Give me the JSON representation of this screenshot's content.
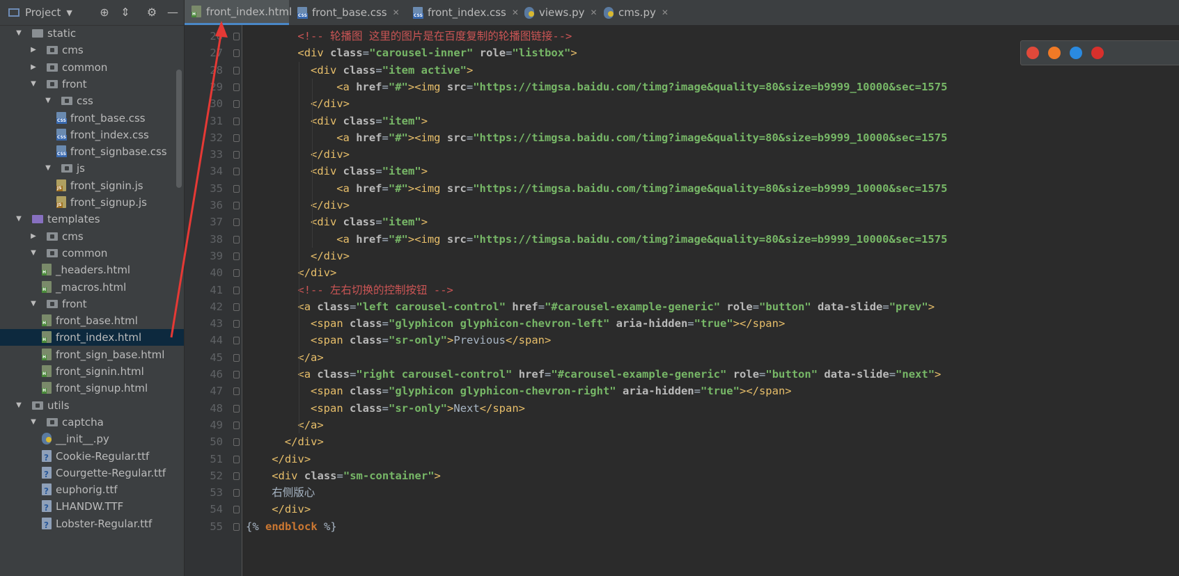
{
  "project_panel": {
    "title": "Project",
    "tree": [
      {
        "label": "static",
        "type": "folder-plain",
        "expanded": true,
        "depth": 0
      },
      {
        "label": "cms",
        "type": "folder",
        "expanded": false,
        "depth": 1
      },
      {
        "label": "common",
        "type": "folder",
        "expanded": false,
        "depth": 1
      },
      {
        "label": "front",
        "type": "folder",
        "expanded": true,
        "depth": 1
      },
      {
        "label": "css",
        "type": "folder",
        "expanded": true,
        "depth": 2
      },
      {
        "label": "front_base.css",
        "type": "css",
        "depth": 3
      },
      {
        "label": "front_index.css",
        "type": "css",
        "depth": 3
      },
      {
        "label": "front_signbase.css",
        "type": "css",
        "depth": 3
      },
      {
        "label": "js",
        "type": "folder",
        "expanded": true,
        "depth": 2
      },
      {
        "label": "front_signin.js",
        "type": "js",
        "depth": 3
      },
      {
        "label": "front_signup.js",
        "type": "js",
        "depth": 3
      },
      {
        "label": "templates",
        "type": "folder-purple",
        "expanded": true,
        "depth": 0
      },
      {
        "label": "cms",
        "type": "folder",
        "expanded": false,
        "depth": 1
      },
      {
        "label": "common",
        "type": "folder",
        "expanded": true,
        "depth": 1
      },
      {
        "label": "_headers.html",
        "type": "html",
        "depth": 2
      },
      {
        "label": "_macros.html",
        "type": "html",
        "depth": 2
      },
      {
        "label": "front",
        "type": "folder",
        "expanded": true,
        "depth": 1
      },
      {
        "label": "front_base.html",
        "type": "html",
        "depth": 2
      },
      {
        "label": "front_index.html",
        "type": "html",
        "depth": 2,
        "selected": true
      },
      {
        "label": "front_sign_base.html",
        "type": "html",
        "depth": 2
      },
      {
        "label": "front_signin.html",
        "type": "html",
        "depth": 2
      },
      {
        "label": "front_signup.html",
        "type": "html",
        "depth": 2
      },
      {
        "label": "utils",
        "type": "folder",
        "expanded": true,
        "depth": 0
      },
      {
        "label": "captcha",
        "type": "folder",
        "expanded": true,
        "depth": 1
      },
      {
        "label": "__init__.py",
        "type": "py",
        "depth": 2
      },
      {
        "label": "Cookie-Regular.ttf",
        "type": "ttf",
        "depth": 2
      },
      {
        "label": "Courgette-Regular.ttf",
        "type": "ttf",
        "depth": 2
      },
      {
        "label": "euphorig.ttf",
        "type": "ttf",
        "depth": 2
      },
      {
        "label": "LHANDW.TTF",
        "type": "ttf",
        "depth": 2
      },
      {
        "label": "Lobster-Regular.ttf",
        "type": "ttf",
        "depth": 2
      }
    ]
  },
  "tabs": [
    {
      "label": "front_index.html",
      "type": "html",
      "active": true
    },
    {
      "label": "front_base.css",
      "type": "css",
      "active": false
    },
    {
      "label": "front_index.css",
      "type": "css",
      "active": false
    },
    {
      "label": "views.py",
      "type": "py",
      "active": false
    },
    {
      "label": "cms.py",
      "type": "py",
      "active": false
    }
  ],
  "editor": {
    "lines": [
      {
        "n": "26",
        "indent": 4,
        "tokens": [
          [
            "comment",
            "<!-- 轮播图 这里的图片是在百度复制的轮播图链接-->"
          ]
        ]
      },
      {
        "n": "27",
        "indent": 4,
        "tokens": [
          [
            "tag",
            "<div "
          ],
          [
            "attrname",
            "class"
          ],
          [
            "txt",
            "="
          ],
          [
            "strv",
            "\"carousel-inner\""
          ],
          [
            "txt",
            " "
          ],
          [
            "attrname",
            "role"
          ],
          [
            "txt",
            "="
          ],
          [
            "strv",
            "\"listbox\""
          ],
          [
            "tag",
            ">"
          ]
        ]
      },
      {
        "n": "28",
        "indent": 5,
        "tokens": [
          [
            "tag",
            "<div "
          ],
          [
            "attrname",
            "class"
          ],
          [
            "txt",
            "="
          ],
          [
            "strv",
            "\"item active\""
          ],
          [
            "tag",
            ">"
          ]
        ]
      },
      {
        "n": "29",
        "indent": 7,
        "tokens": [
          [
            "tag",
            "<a "
          ],
          [
            "attrname",
            "href"
          ],
          [
            "txt",
            "="
          ],
          [
            "strv",
            "\"#\""
          ],
          [
            "tag",
            "><img "
          ],
          [
            "attrname",
            "src"
          ],
          [
            "txt",
            "="
          ],
          [
            "strv",
            "\"https://timgsa.baidu.com/timg?image&quality=80&size=b9999_10000&sec=1575"
          ]
        ]
      },
      {
        "n": "30",
        "indent": 5,
        "tokens": [
          [
            "tag",
            "</div>"
          ]
        ]
      },
      {
        "n": "31",
        "indent": 5,
        "tokens": [
          [
            "tag",
            "<div "
          ],
          [
            "attrname",
            "class"
          ],
          [
            "txt",
            "="
          ],
          [
            "strv",
            "\"item\""
          ],
          [
            "tag",
            ">"
          ]
        ]
      },
      {
        "n": "32",
        "indent": 7,
        "tokens": [
          [
            "tag",
            "<a "
          ],
          [
            "attrname",
            "href"
          ],
          [
            "txt",
            "="
          ],
          [
            "strv",
            "\"#\""
          ],
          [
            "tag",
            "><img "
          ],
          [
            "attrname",
            "src"
          ],
          [
            "txt",
            "="
          ],
          [
            "strv",
            "\"https://timgsa.baidu.com/timg?image&quality=80&size=b9999_10000&sec=1575"
          ]
        ]
      },
      {
        "n": "33",
        "indent": 5,
        "tokens": [
          [
            "tag",
            "</div>"
          ]
        ]
      },
      {
        "n": "34",
        "indent": 5,
        "tokens": [
          [
            "tag",
            "<div "
          ],
          [
            "attrname",
            "class"
          ],
          [
            "txt",
            "="
          ],
          [
            "strv",
            "\"item\""
          ],
          [
            "tag",
            ">"
          ]
        ]
      },
      {
        "n": "35",
        "indent": 7,
        "tokens": [
          [
            "tag",
            "<a "
          ],
          [
            "attrname",
            "href"
          ],
          [
            "txt",
            "="
          ],
          [
            "strv",
            "\"#\""
          ],
          [
            "tag",
            "><img "
          ],
          [
            "attrname",
            "src"
          ],
          [
            "txt",
            "="
          ],
          [
            "strv",
            "\"https://timgsa.baidu.com/timg?image&quality=80&size=b9999_10000&sec=1575"
          ]
        ]
      },
      {
        "n": "36",
        "indent": 5,
        "tokens": [
          [
            "tag",
            "</div>"
          ]
        ]
      },
      {
        "n": "37",
        "indent": 5,
        "tokens": [
          [
            "tag",
            "<div "
          ],
          [
            "attrname",
            "class"
          ],
          [
            "txt",
            "="
          ],
          [
            "strv",
            "\"item\""
          ],
          [
            "tag",
            ">"
          ]
        ]
      },
      {
        "n": "38",
        "indent": 7,
        "tokens": [
          [
            "tag",
            "<a "
          ],
          [
            "attrname",
            "href"
          ],
          [
            "txt",
            "="
          ],
          [
            "strv",
            "\"#\""
          ],
          [
            "tag",
            "><img "
          ],
          [
            "attrname",
            "src"
          ],
          [
            "txt",
            "="
          ],
          [
            "strv",
            "\"https://timgsa.baidu.com/timg?image&quality=80&size=b9999_10000&sec=1575"
          ]
        ]
      },
      {
        "n": "39",
        "indent": 5,
        "tokens": [
          [
            "tag",
            "</div>"
          ]
        ]
      },
      {
        "n": "40",
        "indent": 4,
        "tokens": [
          [
            "tag",
            "</div>"
          ]
        ]
      },
      {
        "n": "41",
        "indent": 4,
        "tokens": [
          [
            "comment",
            "<!-- 左右切换的控制按钮 -->"
          ]
        ]
      },
      {
        "n": "42",
        "indent": 4,
        "tokens": [
          [
            "tag",
            "<a "
          ],
          [
            "attrname",
            "class"
          ],
          [
            "txt",
            "="
          ],
          [
            "strv",
            "\"left carousel-control\""
          ],
          [
            "txt",
            " "
          ],
          [
            "attrname",
            "href"
          ],
          [
            "txt",
            "="
          ],
          [
            "strv",
            "\"#carousel-example-generic\""
          ],
          [
            "txt",
            " "
          ],
          [
            "attrname",
            "role"
          ],
          [
            "txt",
            "="
          ],
          [
            "strv",
            "\"button\""
          ],
          [
            "txt",
            " "
          ],
          [
            "attrname",
            "data-slide"
          ],
          [
            "txt",
            "="
          ],
          [
            "strv",
            "\"prev\""
          ],
          [
            "tag",
            ">"
          ]
        ]
      },
      {
        "n": "43",
        "indent": 5,
        "tokens": [
          [
            "tag",
            "<span "
          ],
          [
            "attrname",
            "class"
          ],
          [
            "txt",
            "="
          ],
          [
            "strv",
            "\"glyphicon glyphicon-chevron-left\""
          ],
          [
            "txt",
            " "
          ],
          [
            "attrname",
            "aria-hidden"
          ],
          [
            "txt",
            "="
          ],
          [
            "strv",
            "\"true\""
          ],
          [
            "tag",
            "></span>"
          ]
        ]
      },
      {
        "n": "44",
        "indent": 5,
        "tokens": [
          [
            "tag",
            "<span "
          ],
          [
            "attrname",
            "class"
          ],
          [
            "txt",
            "="
          ],
          [
            "strv",
            "\"sr-only\""
          ],
          [
            "tag",
            ">"
          ],
          [
            "txt",
            "Previous"
          ],
          [
            "tag",
            "</span>"
          ]
        ]
      },
      {
        "n": "45",
        "indent": 4,
        "tokens": [
          [
            "tag",
            "</a>"
          ]
        ]
      },
      {
        "n": "46",
        "indent": 4,
        "tokens": [
          [
            "tag",
            "<a "
          ],
          [
            "attrname",
            "class"
          ],
          [
            "txt",
            "="
          ],
          [
            "strv",
            "\"right carousel-control\""
          ],
          [
            "txt",
            " "
          ],
          [
            "attrname",
            "href"
          ],
          [
            "txt",
            "="
          ],
          [
            "strv",
            "\"#carousel-example-generic\""
          ],
          [
            "txt",
            " "
          ],
          [
            "attrname",
            "role"
          ],
          [
            "txt",
            "="
          ],
          [
            "strv",
            "\"button\""
          ],
          [
            "txt",
            " "
          ],
          [
            "attrname",
            "data-slide"
          ],
          [
            "txt",
            "="
          ],
          [
            "strv",
            "\"next\""
          ],
          [
            "tag",
            ">"
          ]
        ]
      },
      {
        "n": "47",
        "indent": 5,
        "tokens": [
          [
            "tag",
            "<span "
          ],
          [
            "attrname",
            "class"
          ],
          [
            "txt",
            "="
          ],
          [
            "strv",
            "\"glyphicon glyphicon-chevron-right\""
          ],
          [
            "txt",
            " "
          ],
          [
            "attrname",
            "aria-hidden"
          ],
          [
            "txt",
            "="
          ],
          [
            "strv",
            "\"true\""
          ],
          [
            "tag",
            "></span>"
          ]
        ]
      },
      {
        "n": "48",
        "indent": 5,
        "tokens": [
          [
            "tag",
            "<span "
          ],
          [
            "attrname",
            "class"
          ],
          [
            "txt",
            "="
          ],
          [
            "strv",
            "\"sr-only\""
          ],
          [
            "tag",
            ">"
          ],
          [
            "txt",
            "Next"
          ],
          [
            "tag",
            "</span>"
          ]
        ]
      },
      {
        "n": "49",
        "indent": 4,
        "tokens": [
          [
            "tag",
            "</a>"
          ]
        ]
      },
      {
        "n": "50",
        "indent": 3,
        "tokens": [
          [
            "tag",
            "</div>"
          ]
        ]
      },
      {
        "n": "51",
        "indent": 2,
        "tokens": [
          [
            "tag",
            "</div>"
          ]
        ]
      },
      {
        "n": "52",
        "indent": 2,
        "tokens": [
          [
            "tag",
            "<div "
          ],
          [
            "attrname",
            "class"
          ],
          [
            "txt",
            "="
          ],
          [
            "strv",
            "\"sm-container\""
          ],
          [
            "tag",
            ">"
          ]
        ]
      },
      {
        "n": "53",
        "indent": 2,
        "tokens": [
          [
            "txt",
            "右侧版心"
          ]
        ]
      },
      {
        "n": "54",
        "indent": 2,
        "tokens": [
          [
            "tag",
            "</div>"
          ]
        ]
      },
      {
        "n": "55",
        "indent": 0,
        "tokens": [
          [
            "tplb",
            "{% "
          ],
          [
            "tplkw",
            "endblock"
          ],
          [
            "tplb",
            " %}"
          ]
        ]
      }
    ]
  },
  "browser_popup": {
    "icons": [
      "chrome-icon",
      "firefox-icon",
      "safari-icon",
      "opera-icon"
    ]
  },
  "colors": {
    "tag": "#e8bf6a",
    "attr": "#bababa",
    "string": "#77b767",
    "comment": "#cc5555",
    "text": "#a9b7c6",
    "accent": "#4a88c7",
    "annotation_arrow": "#e53935"
  }
}
